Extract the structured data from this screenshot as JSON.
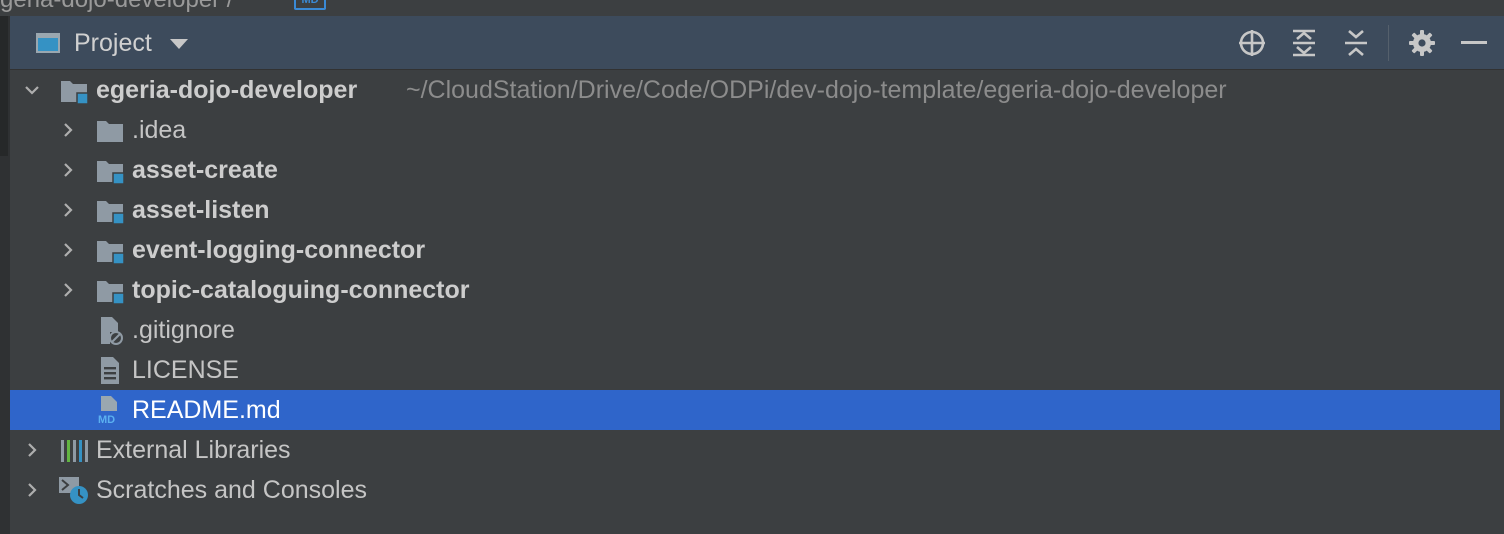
{
  "breadcrumb": {
    "text": "geria-dojo-developer  /"
  },
  "panel": {
    "title": "Project",
    "accent_color": "#3592c4",
    "selection_color": "#2f65ca",
    "toolbar": [
      {
        "name": "locate-icon"
      },
      {
        "name": "expand-all-icon"
      },
      {
        "name": "collapse-all-icon"
      },
      {
        "name": "gear-icon"
      },
      {
        "name": "minimize-icon"
      }
    ]
  },
  "tree": {
    "root": {
      "label": "egeria-dojo-developer",
      "path": "~/CloudStation/Drive/Code/ODPi/dev-dojo-template/egeria-dojo-developer",
      "expanded": true
    },
    "children": [
      {
        "label": ".idea",
        "kind": "folder",
        "module": false
      },
      {
        "label": "asset-create",
        "kind": "folder",
        "module": true
      },
      {
        "label": "asset-listen",
        "kind": "folder",
        "module": true
      },
      {
        "label": "event-logging-connector",
        "kind": "folder",
        "module": true
      },
      {
        "label": "topic-cataloguing-connector",
        "kind": "folder",
        "module": true
      },
      {
        "label": ".gitignore",
        "kind": "file-ignore"
      },
      {
        "label": "LICENSE",
        "kind": "file-text"
      },
      {
        "label": "README.md",
        "kind": "file-md",
        "selected": true
      }
    ],
    "external_libraries": {
      "label": "External Libraries"
    },
    "scratches": {
      "label": "Scratches and Consoles"
    }
  }
}
